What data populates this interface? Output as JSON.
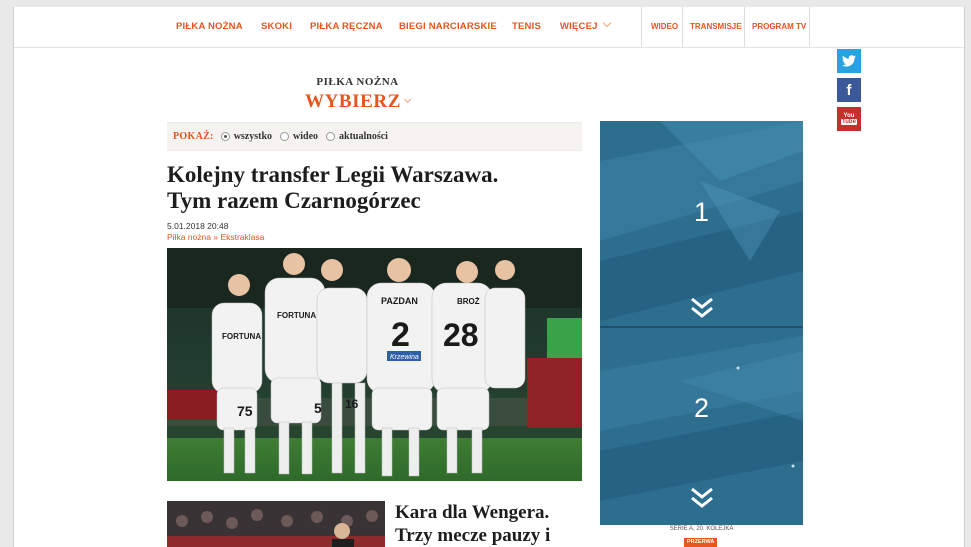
{
  "nav": {
    "items": [
      {
        "label": "PIŁKA NOŻNA"
      },
      {
        "label": "SKOKI"
      },
      {
        "label": "PIŁKA RĘCZNA"
      },
      {
        "label": "BIEGI NARCIARSKIE"
      },
      {
        "label": "TENIS"
      },
      {
        "label": "WIĘCEJ"
      }
    ],
    "right": [
      {
        "label": "WIDEO"
      },
      {
        "label": "TRANSMISJE"
      },
      {
        "label": "PROGRAM TV"
      }
    ]
  },
  "social": {
    "twitter_icon": "twitter-icon",
    "facebook_label": "f",
    "youtube_label_top": "You",
    "youtube_label_bottom": "Tube"
  },
  "section": {
    "label": "PIŁKA NOŻNA",
    "select_label": "WYBIERZ"
  },
  "filter": {
    "label": "POKAŻ:",
    "options": [
      {
        "label": "wszystko",
        "selected": true
      },
      {
        "label": "wideo",
        "selected": false
      },
      {
        "label": "aktualności",
        "selected": false
      }
    ]
  },
  "article": {
    "title_line1": "Kolejny transfer Legii Warszawa.",
    "title_line2": "Tym razem Czarnogórzec",
    "date": "5.01.2018 20:48",
    "breadcrumb_section": "Piłka nożna",
    "breadcrumb_sep": "»",
    "breadcrumb_category": "Ekstraklasa",
    "image_texts": {
      "shirt1": "2",
      "shirt1_name": "PAZDAN",
      "shirt2": "28",
      "shirt2_name": "BROŻ",
      "shirt3": "75",
      "shirt4": "5",
      "shirt5": "16",
      "sponsor": "FORTUNA",
      "sponsor2": "Krzewina"
    }
  },
  "secondary": {
    "title_line1": "Kara dla Wengera.",
    "title_line2": "Trzy mecze pauzy i"
  },
  "scoreboard": {
    "slots": [
      {
        "number": "1"
      },
      {
        "number": "2"
      }
    ],
    "info": "SERIE A, 20. KOLEJKA",
    "badge": "PRZERWA",
    "colors": {
      "bg": "#2d6d8e",
      "accent": "#e8541e"
    }
  }
}
